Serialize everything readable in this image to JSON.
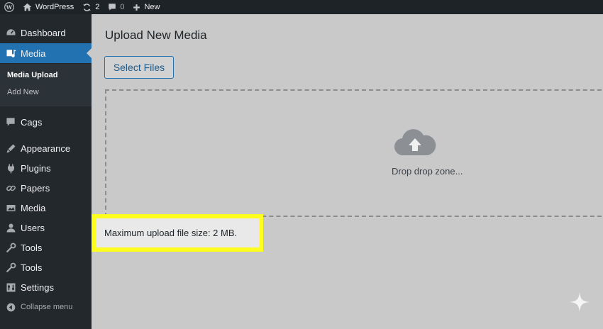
{
  "adminbar": {
    "site_name": "WordPress",
    "updates_count": "2",
    "comments_count": "0",
    "new_label": "New"
  },
  "sidebar": {
    "items": [
      {
        "label": "Dashboard",
        "icon": "dashboard-icon"
      },
      {
        "label": "Media",
        "icon": "media-icon",
        "current": true
      },
      {
        "label": "Cags",
        "icon": "comments-icon"
      },
      {
        "label": "Appearance",
        "icon": "appearance-icon"
      },
      {
        "label": "Plugins",
        "icon": "plugins-icon"
      },
      {
        "label": "Papers",
        "icon": "links-icon"
      },
      {
        "label": "Media",
        "icon": "media-library-icon"
      },
      {
        "label": "Users",
        "icon": "users-icon"
      },
      {
        "label": "Tools",
        "icon": "tools-icon"
      },
      {
        "label": "Tools",
        "icon": "tools-icon"
      },
      {
        "label": "Settings",
        "icon": "settings-icon"
      }
    ],
    "submenu": [
      {
        "label": "Media Upload",
        "current": true
      },
      {
        "label": "Add New"
      }
    ],
    "collapse_label": "Collapse menu"
  },
  "main": {
    "title": "Upload New Media",
    "select_files_label": "Select Files",
    "drop_text": "Drop drop zone...",
    "max_upload_notice": "Maximum upload file size: 2 MB."
  },
  "colors": {
    "sidebar_bg": "#23282d",
    "accent": "#2271b1",
    "highlight": "#ffff1f",
    "content_bg": "#c9c9c9"
  }
}
